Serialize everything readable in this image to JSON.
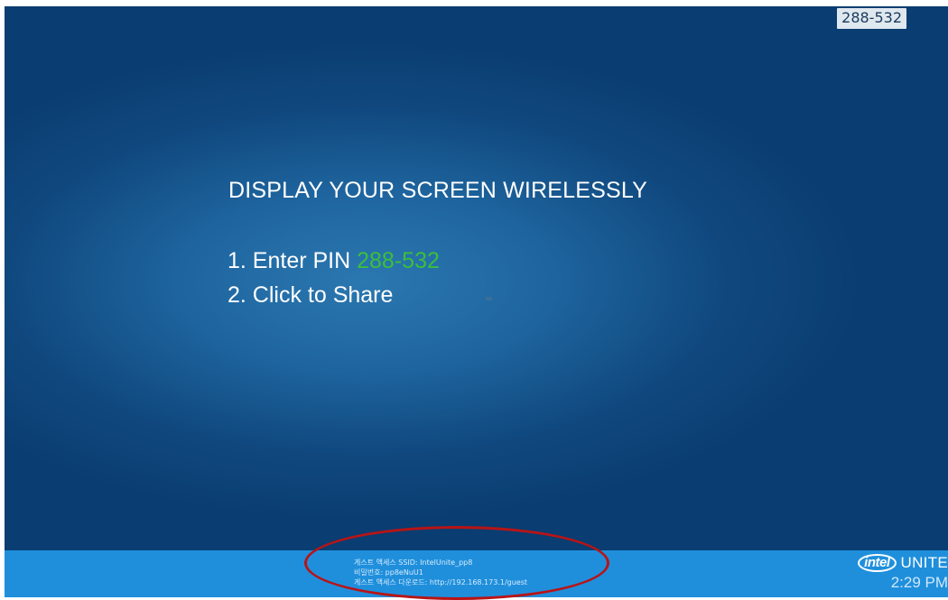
{
  "screen": {
    "pin_badge": "288-532",
    "headline": "DISPLAY YOUR SCREEN WIRELESSLY",
    "step1_prefix": "1. Enter PIN ",
    "step1_pin": "288-532",
    "step2": "2. Click to Share"
  },
  "footer": {
    "guest_ssid": "게스트 액세스 SSID: IntelUnite_pp8",
    "guest_password": "비밀번호: pp8eNuU1",
    "guest_download": "게스트 액세스 다운로드: http://192.168.173.1/guest",
    "brand_logo": "intel",
    "brand_name": "UNITE",
    "clock": "2:29 PM"
  },
  "colors": {
    "background_dark": "#0a3d71",
    "background_glow": "#2b77b0",
    "bottom_bar": "#1f8fdc",
    "pin_green": "#3bbf3b",
    "annotation_red": "#b81416"
  },
  "icons": {
    "brand": "intel-logo-icon"
  }
}
